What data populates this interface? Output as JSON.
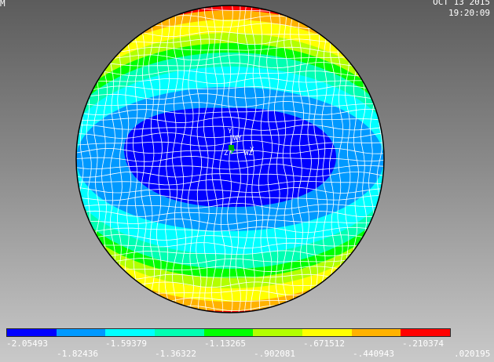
{
  "header": {
    "left_label": "M",
    "date": "OCT 13 2015",
    "time": "19:20:09"
  },
  "triad": {
    "y_label": "Y",
    "z_label": "Z",
    "x_label": "X",
    "wy_label": "WY",
    "wz_label": "WZ"
  },
  "legend": {
    "colors": [
      "#0000ff",
      "#0099ff",
      "#00ffff",
      "#00ffb2",
      "#00ff00",
      "#b2ff00",
      "#ffff00",
      "#ffb200",
      "#ff0000"
    ],
    "top_row": [
      "-2.05493",
      "-1.59379",
      "-1.13265",
      "-.671512",
      "-.210374"
    ],
    "bottom_row": [
      "-1.82436",
      "-1.36322",
      "-.902081",
      "-.440943",
      ".020195"
    ]
  },
  "contour_colors": {
    "blue": "#0000ff",
    "sky": "#0099ff",
    "cyan": "#00ffff",
    "aqua": "#00ffb2",
    "green": "#00ff00",
    "lime": "#b2ff00",
    "yellow": "#ffff00",
    "orange": "#ffb200",
    "red": "#ff0000"
  }
}
